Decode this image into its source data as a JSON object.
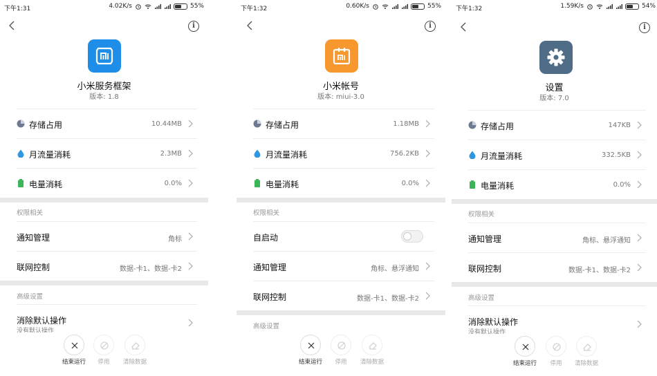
{
  "panels": [
    {
      "status": {
        "time": "下午1:31",
        "speed": "4.02K/s",
        "battery": "55%",
        "battery_level": 0.55
      },
      "app": {
        "name": "小米服务框架",
        "version": "版本: 1.8",
        "icon_color": "#1f8ee8",
        "icon_name": "mi-logo-icon"
      },
      "rows": [
        {
          "label": "存储占用",
          "value": "10.44MB",
          "icon": "storage-pie-icon"
        },
        {
          "label": "月流量消耗",
          "value": "2.3MB",
          "icon": "water-drop-icon"
        },
        {
          "label": "电量消耗",
          "value": "0.0%",
          "icon": "battery-icon"
        }
      ],
      "sections": [
        {
          "title": "权限相关",
          "rows": [
            {
              "label": "通知管理",
              "value": "角标"
            },
            {
              "label": "联网控制",
              "value": "数据-卡1、数据-卡2"
            }
          ]
        },
        {
          "title": "高级设置",
          "rows": [
            {
              "label": "消除默认操作",
              "sub": "没有默认操作"
            }
          ]
        }
      ],
      "buttons": {
        "stop": "结束运行",
        "disable": "停用",
        "clear": "清除数据"
      }
    },
    {
      "status": {
        "time": "下午1:32",
        "speed": "0.60K/s",
        "battery": "55%",
        "battery_level": 0.55
      },
      "app": {
        "name": "小米帐号",
        "version": "版本: miui-3.0",
        "icon_color": "#f7982f",
        "icon_name": "mi-account-icon"
      },
      "rows": [
        {
          "label": "存储占用",
          "value": "1.18MB",
          "icon": "storage-pie-icon"
        },
        {
          "label": "月流量消耗",
          "value": "756.2KB",
          "icon": "water-drop-icon"
        },
        {
          "label": "电量消耗",
          "value": "0.0%",
          "icon": "battery-icon"
        }
      ],
      "sections": [
        {
          "title": "权限相关",
          "rows": [
            {
              "label": "自启动",
              "toggle": true
            },
            {
              "label": "通知管理",
              "value": "角标、悬浮通知"
            },
            {
              "label": "联网控制",
              "value": "数据-卡1、数据-卡2"
            }
          ]
        },
        {
          "title": "高级设置",
          "rows": []
        }
      ],
      "buttons": {
        "stop": "结束运行",
        "disable": "停用",
        "clear": "清除数据"
      }
    },
    {
      "status": {
        "time": "下午1:32",
        "speed": "1.59K/s",
        "battery": "54%",
        "battery_level": 0.54
      },
      "app": {
        "name": "设置",
        "version": "版本: 7.0",
        "icon_color": "#4f6d87",
        "icon_name": "gear-icon"
      },
      "rows": [
        {
          "label": "存储占用",
          "value": "147KB",
          "icon": "storage-pie-icon"
        },
        {
          "label": "月流量消耗",
          "value": "332.5KB",
          "icon": "water-drop-icon"
        },
        {
          "label": "电量消耗",
          "value": "0.0%",
          "icon": "battery-icon"
        }
      ],
      "sections": [
        {
          "title": "权限相关",
          "rows": [
            {
              "label": "通知管理",
              "value": "角标、悬浮通知"
            },
            {
              "label": "联网控制",
              "value": "数据-卡1、数据-卡2"
            }
          ]
        },
        {
          "title": "高级设置",
          "rows": [
            {
              "label": "消除默认操作",
              "sub": "没有默认操作"
            }
          ]
        }
      ],
      "buttons": {
        "stop": "结束运行",
        "disable": "停用",
        "clear": "清除数据"
      }
    }
  ],
  "colors": {
    "pie": "#6e7a92",
    "drop": "#2f97e0",
    "battery": "#3cb458"
  }
}
